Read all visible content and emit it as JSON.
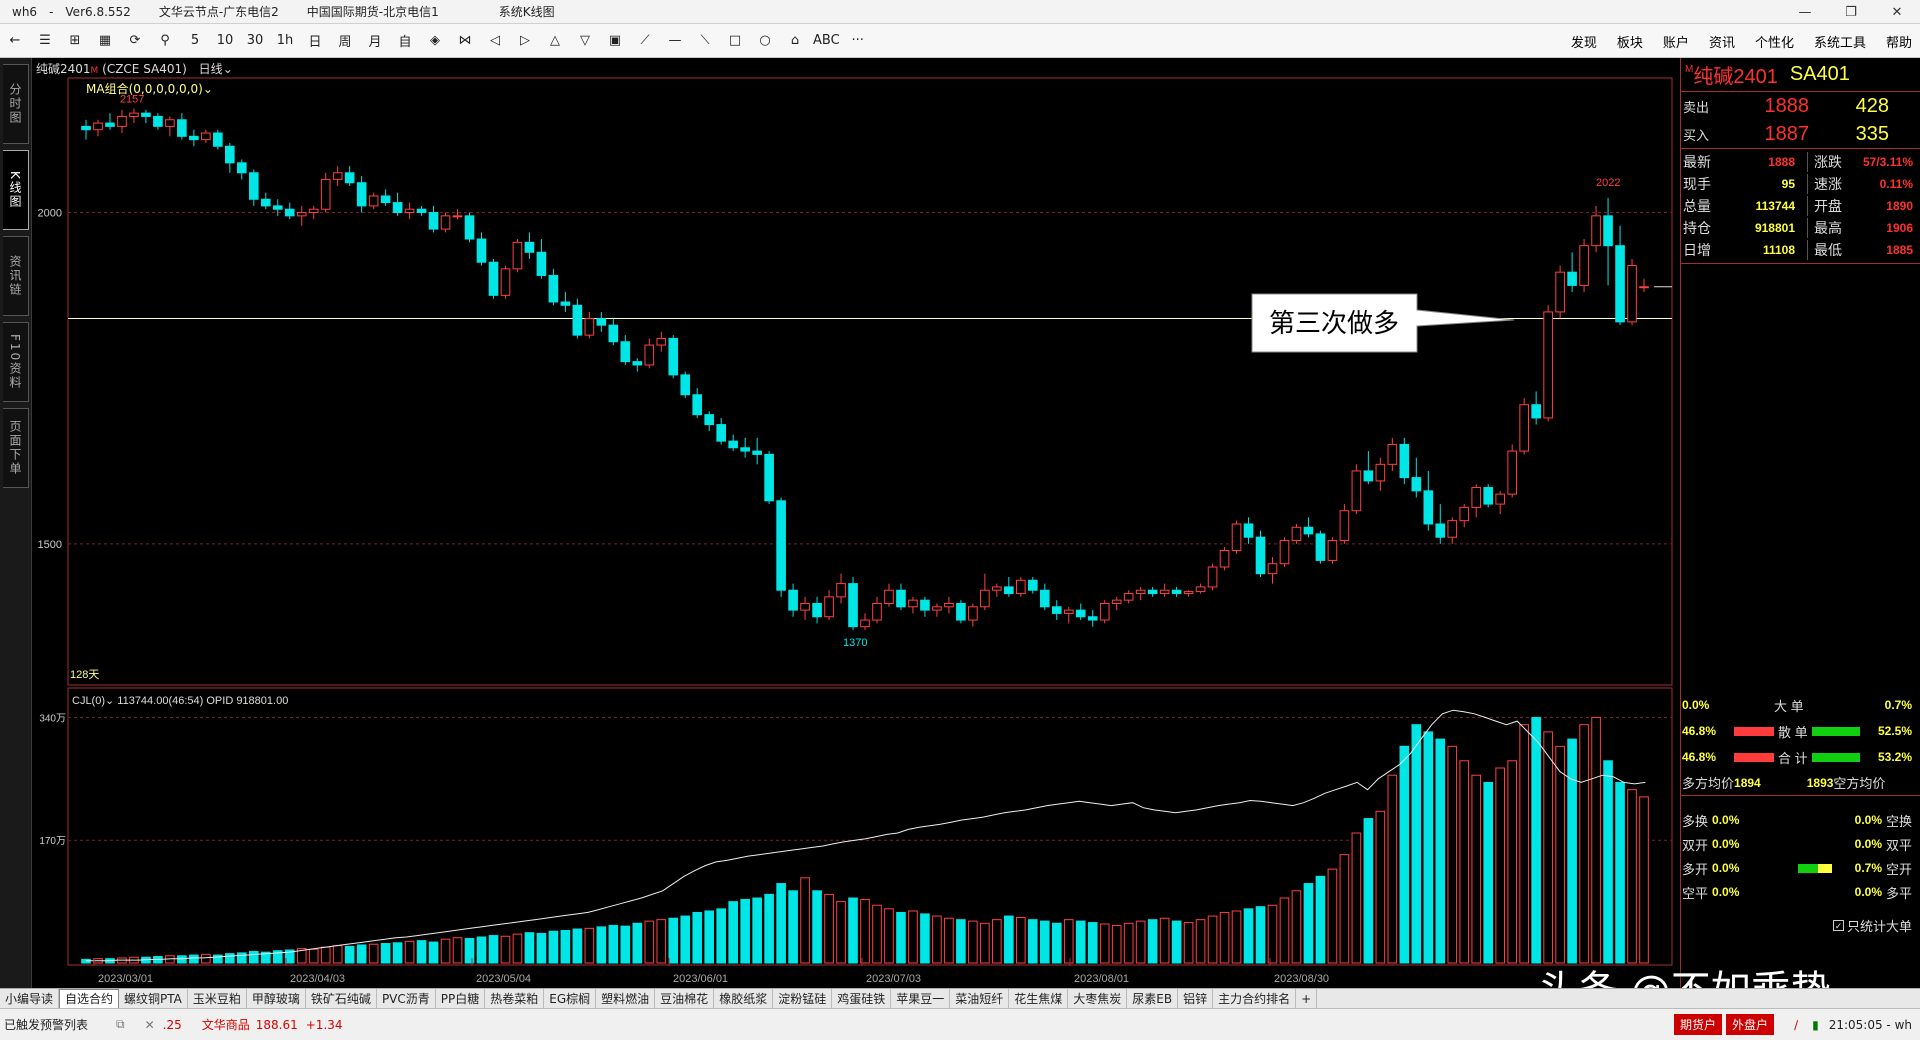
{
  "window": {
    "app": "wh6",
    "dash": "-",
    "version": "Ver6.8.552",
    "server1": "文华云节点-广东电信2",
    "server2": "中国国际期货-北京电信1",
    "title": "系统K线图",
    "minimize": "—",
    "restore": "❐",
    "close": "✕"
  },
  "toolbar": {
    "items": [
      "←",
      "☰",
      "⊞",
      "▦",
      "⟳",
      "⚲",
      "5",
      "10",
      "30",
      "1h",
      "日",
      "周",
      "月",
      "自",
      "◈",
      "⋈",
      "◁",
      "▷",
      "△",
      "▽",
      "▣",
      "⟋",
      "—",
      "⟍",
      "□",
      "○",
      "⌂",
      "ABC",
      "···"
    ],
    "right_menu": [
      "发现",
      "板块",
      "账户",
      "资讯",
      "个性化",
      "系统工具",
      "帮助"
    ]
  },
  "left_tabs": [
    "分时图",
    "K线图",
    "资讯链",
    "F10资料",
    "页面下单"
  ],
  "chart_header": {
    "symbol": "纯碱2401",
    "mark": "M",
    "code": "(CZCE SA401)",
    "period": "日线",
    "ma_label": "MA组合(0,0,0,0,0,0)",
    "days_label": "128天",
    "annotation": "第三次做多",
    "high_label": "2157",
    "low_label": "1370",
    "recent_high_label": "2022",
    "y_tick_2000": "2000",
    "y_tick_1500": "1500",
    "vol_header": "CJL(0)",
    "vol_value": "113744.00(46:54)",
    "opid": "OPID 918801.00",
    "vol_tick_340": "340万",
    "vol_tick_170": "170万"
  },
  "chart_data": {
    "type": "candlestick",
    "title": "纯碱2401 (CZCE SA401) 日线",
    "x_ticks": [
      "2023/03/01",
      "2023/04/03",
      "2023/05/04",
      "2023/06/01",
      "2023/07/03",
      "2023/08/01",
      "2023/08/30"
    ],
    "y_ticks": [
      2000,
      1500
    ],
    "ylim": [
      1290,
      2200
    ],
    "annotations": [
      {
        "text": "2157",
        "value": 2157
      },
      {
        "text": "1370",
        "value": 1370
      },
      {
        "text": "2022",
        "value": 2022
      },
      {
        "text": "第三次做多",
        "value": 1830
      }
    ],
    "horizontal_line": 1840,
    "ohlc": [
      [
        2130,
        2140,
        2110,
        2125
      ],
      [
        2125,
        2140,
        2115,
        2135
      ],
      [
        2135,
        2150,
        2125,
        2130
      ],
      [
        2130,
        2155,
        2120,
        2145
      ],
      [
        2145,
        2157,
        2135,
        2150
      ],
      [
        2150,
        2155,
        2135,
        2145
      ],
      [
        2145,
        2150,
        2125,
        2130
      ],
      [
        2130,
        2145,
        2115,
        2140
      ],
      [
        2140,
        2150,
        2110,
        2115
      ],
      [
        2115,
        2125,
        2100,
        2110
      ],
      [
        2110,
        2125,
        2105,
        2120
      ],
      [
        2120,
        2125,
        2095,
        2100
      ],
      [
        2100,
        2105,
        2060,
        2075
      ],
      [
        2075,
        2080,
        2050,
        2060
      ],
      [
        2060,
        2065,
        2010,
        2020
      ],
      [
        2020,
        2030,
        2005,
        2010
      ],
      [
        2010,
        2020,
        1995,
        2005
      ],
      [
        2005,
        2015,
        1990,
        1995
      ],
      [
        1995,
        2010,
        1980,
        2000
      ],
      [
        2000,
        2010,
        1990,
        2005
      ],
      [
        2005,
        2060,
        2000,
        2050
      ],
      [
        2050,
        2070,
        2040,
        2060
      ],
      [
        2060,
        2070,
        2040,
        2045
      ],
      [
        2045,
        2055,
        2000,
        2010
      ],
      [
        2010,
        2030,
        2005,
        2025
      ],
      [
        2025,
        2035,
        2010,
        2015
      ],
      [
        2015,
        2030,
        1995,
        2000
      ],
      [
        2000,
        2015,
        1990,
        2005
      ],
      [
        2005,
        2010,
        1995,
        2000
      ],
      [
        2000,
        2010,
        1970,
        1975
      ],
      [
        1975,
        2000,
        1970,
        1995
      ],
      [
        1995,
        2005,
        1990,
        1995
      ],
      [
        1995,
        2000,
        1955,
        1960
      ],
      [
        1960,
        1970,
        1920,
        1925
      ],
      [
        1925,
        1930,
        1870,
        1875
      ],
      [
        1875,
        1920,
        1870,
        1915
      ],
      [
        1915,
        1960,
        1910,
        1955
      ],
      [
        1955,
        1970,
        1930,
        1940
      ],
      [
        1940,
        1960,
        1900,
        1905
      ],
      [
        1905,
        1915,
        1860,
        1865
      ],
      [
        1865,
        1880,
        1850,
        1860
      ],
      [
        1860,
        1870,
        1810,
        1815
      ],
      [
        1815,
        1850,
        1810,
        1840
      ],
      [
        1840,
        1850,
        1820,
        1830
      ],
      [
        1830,
        1840,
        1800,
        1805
      ],
      [
        1805,
        1815,
        1770,
        1775
      ],
      [
        1775,
        1780,
        1760,
        1770
      ],
      [
        1770,
        1810,
        1765,
        1800
      ],
      [
        1800,
        1820,
        1790,
        1810
      ],
      [
        1810,
        1815,
        1750,
        1755
      ],
      [
        1755,
        1760,
        1720,
        1725
      ],
      [
        1725,
        1735,
        1690,
        1695
      ],
      [
        1695,
        1700,
        1670,
        1680
      ],
      [
        1680,
        1690,
        1650,
        1655
      ],
      [
        1655,
        1665,
        1640,
        1645
      ],
      [
        1645,
        1660,
        1630,
        1640
      ],
      [
        1640,
        1660,
        1620,
        1635
      ],
      [
        1635,
        1640,
        1560,
        1565
      ],
      [
        1565,
        1570,
        1420,
        1430
      ],
      [
        1430,
        1440,
        1390,
        1400
      ],
      [
        1400,
        1420,
        1385,
        1410
      ],
      [
        1410,
        1420,
        1380,
        1390
      ],
      [
        1390,
        1430,
        1385,
        1420
      ],
      [
        1420,
        1455,
        1410,
        1440
      ],
      [
        1440,
        1450,
        1370,
        1375
      ],
      [
        1375,
        1395,
        1370,
        1385
      ],
      [
        1385,
        1420,
        1380,
        1410
      ],
      [
        1410,
        1440,
        1405,
        1430
      ],
      [
        1430,
        1440,
        1400,
        1405
      ],
      [
        1405,
        1420,
        1395,
        1415
      ],
      [
        1415,
        1420,
        1390,
        1400
      ],
      [
        1400,
        1410,
        1390,
        1405
      ],
      [
        1405,
        1420,
        1395,
        1410
      ],
      [
        1410,
        1415,
        1380,
        1385
      ],
      [
        1385,
        1410,
        1375,
        1405
      ],
      [
        1405,
        1455,
        1400,
        1430
      ],
      [
        1430,
        1440,
        1420,
        1435
      ],
      [
        1435,
        1450,
        1420,
        1425
      ],
      [
        1425,
        1450,
        1420,
        1445
      ],
      [
        1445,
        1450,
        1425,
        1430
      ],
      [
        1430,
        1440,
        1400,
        1405
      ],
      [
        1405,
        1415,
        1385,
        1395
      ],
      [
        1395,
        1405,
        1380,
        1400
      ],
      [
        1400,
        1410,
        1385,
        1390
      ],
      [
        1390,
        1400,
        1375,
        1385
      ],
      [
        1385,
        1415,
        1380,
        1410
      ],
      [
        1410,
        1420,
        1400,
        1415
      ],
      [
        1415,
        1430,
        1410,
        1425
      ],
      [
        1425,
        1435,
        1415,
        1430
      ],
      [
        1430,
        1435,
        1420,
        1425
      ],
      [
        1425,
        1440,
        1420,
        1430
      ],
      [
        1430,
        1435,
        1420,
        1425
      ],
      [
        1425,
        1430,
        1420,
        1428
      ],
      [
        1428,
        1440,
        1425,
        1435
      ],
      [
        1435,
        1470,
        1430,
        1465
      ],
      [
        1465,
        1495,
        1460,
        1490
      ],
      [
        1490,
        1535,
        1485,
        1530
      ],
      [
        1530,
        1540,
        1500,
        1510
      ],
      [
        1510,
        1520,
        1450,
        1455
      ],
      [
        1455,
        1480,
        1440,
        1470
      ],
      [
        1470,
        1510,
        1465,
        1505
      ],
      [
        1505,
        1530,
        1500,
        1525
      ],
      [
        1525,
        1540,
        1510,
        1515
      ],
      [
        1515,
        1520,
        1470,
        1475
      ],
      [
        1475,
        1510,
        1470,
        1505
      ],
      [
        1505,
        1560,
        1500,
        1550
      ],
      [
        1550,
        1620,
        1545,
        1610
      ],
      [
        1610,
        1640,
        1590,
        1595
      ],
      [
        1595,
        1630,
        1580,
        1620
      ],
      [
        1620,
        1660,
        1610,
        1650
      ],
      [
        1650,
        1660,
        1590,
        1600
      ],
      [
        1600,
        1630,
        1570,
        1580
      ],
      [
        1580,
        1610,
        1520,
        1530
      ],
      [
        1530,
        1560,
        1500,
        1510
      ],
      [
        1510,
        1540,
        1500,
        1535
      ],
      [
        1535,
        1560,
        1525,
        1555
      ],
      [
        1555,
        1590,
        1540,
        1585
      ],
      [
        1585,
        1590,
        1555,
        1560
      ],
      [
        1560,
        1580,
        1545,
        1575
      ],
      [
        1575,
        1650,
        1570,
        1640
      ],
      [
        1640,
        1720,
        1635,
        1710
      ],
      [
        1710,
        1730,
        1680,
        1690
      ],
      [
        1690,
        1860,
        1685,
        1850
      ],
      [
        1850,
        1920,
        1840,
        1910
      ],
      [
        1910,
        1940,
        1880,
        1890
      ],
      [
        1890,
        1960,
        1880,
        1950
      ],
      [
        1950,
        2010,
        1940,
        1995
      ],
      [
        1995,
        2022,
        1890,
        1950
      ],
      [
        1950,
        1980,
        1830,
        1835
      ],
      [
        1835,
        1930,
        1830,
        1920
      ],
      [
        1887,
        1900,
        1880,
        1888
      ]
    ],
    "volume_wan": [
      5,
      6,
      6,
      7,
      8,
      8,
      9,
      10,
      10,
      11,
      12,
      11,
      13,
      14,
      16,
      15,
      17,
      18,
      20,
      19,
      22,
      24,
      23,
      25,
      26,
      27,
      28,
      30,
      31,
      29,
      33,
      35,
      34,
      36,
      38,
      37,
      40,
      42,
      41,
      44,
      45,
      47,
      48,
      50,
      52,
      51,
      55,
      58,
      60,
      62,
      65,
      70,
      72,
      75,
      85,
      88,
      90,
      95,
      110,
      100,
      118,
      100,
      95,
      85,
      90,
      88,
      80,
      75,
      70,
      72,
      68,
      65,
      62,
      60,
      58,
      55,
      60,
      65,
      63,
      60,
      58,
      55,
      60,
      58,
      56,
      54,
      52,
      55,
      58,
      60,
      62,
      58,
      56,
      60,
      65,
      70,
      72,
      75,
      78,
      80,
      90,
      100,
      110,
      120,
      130,
      150,
      180,
      200,
      210,
      260,
      300,
      330,
      320,
      310,
      300,
      280,
      260,
      250,
      270,
      280,
      330,
      340,
      320,
      300,
      310,
      330,
      340,
      280,
      250,
      240,
      230,
      6
    ],
    "open_interest_wan": [
      3,
      3,
      3,
      4,
      4,
      4,
      5,
      5,
      6,
      6,
      7,
      7,
      8,
      9,
      10,
      11,
      12,
      13,
      14,
      15,
      17,
      19,
      21,
      23,
      25,
      27,
      29,
      31,
      33,
      35,
      36,
      38,
      40,
      42,
      44,
      46,
      48,
      50,
      52,
      54,
      56,
      58,
      60,
      62,
      64,
      66,
      68,
      70,
      74,
      78,
      82,
      86,
      90,
      95,
      100,
      110,
      120,
      128,
      135,
      140,
      142,
      145,
      148,
      150,
      152,
      154,
      156,
      158,
      160,
      162,
      165,
      168,
      170,
      172,
      175,
      178,
      180,
      185,
      188,
      190,
      192,
      195,
      198,
      200,
      202,
      205,
      208,
      210,
      212,
      215,
      218,
      220,
      222,
      224,
      222,
      220,
      218,
      220,
      222,
      215,
      212,
      210,
      208,
      210,
      212,
      215,
      218,
      220,
      222,
      225,
      224,
      222,
      220,
      218,
      222,
      228,
      235,
      240,
      245,
      250,
      240,
      255,
      265,
      275,
      290,
      310,
      330,
      345,
      350,
      348,
      345,
      340,
      335,
      330,
      335,
      320,
      305,
      285,
      265,
      255,
      250,
      255,
      260,
      258,
      250,
      248,
      250
    ]
  },
  "quote": {
    "mark": "M",
    "name": "纯碱2401",
    "code": "SA401",
    "ask_label": "卖出",
    "ask_price": "1888",
    "ask_vol": "428",
    "bid_label": "买入",
    "bid_price": "1887",
    "bid_vol": "335",
    "rows": [
      {
        "l1": "最新",
        "v1": "1888",
        "l2": "涨跌",
        "v2": "57/3.11%"
      },
      {
        "l1": "现手",
        "v1": "95",
        "l2": "速涨",
        "v2": "0.11%"
      },
      {
        "l1": "总量",
        "v1": "113744",
        "l2": "开盘",
        "v2": "1890"
      },
      {
        "l1": "持仓",
        "v1": "918801",
        "l2": "最高",
        "v2": "1906"
      },
      {
        "l1": "日增",
        "v1": "11108",
        "l2": "最低",
        "v2": "1885"
      }
    ]
  },
  "flow": {
    "big_left": "0.0%",
    "big_label": "大 单",
    "big_right": "0.7%",
    "retail_left": "46.8%",
    "retail_label": "散 单",
    "retail_right": "52.5%",
    "total_left": "46.8%",
    "total_label": "合 计",
    "total_right": "53.2%",
    "long_avg_label": "多方均价",
    "long_avg": "1894",
    "short_avg": "1893",
    "short_avg_label": "空方均价",
    "rows": [
      {
        "l": "多换",
        "lv": "0.0%",
        "rv": "0.0%",
        "r": "空换"
      },
      {
        "l": "双开",
        "lv": "0.0%",
        "rv": "0.0%",
        "r": "双平"
      },
      {
        "l": "多开",
        "lv": "0.0%",
        "rv": "0.7%",
        "r": "空开"
      },
      {
        "l": "空平",
        "lv": "0.0%",
        "rv": "0.0%",
        "r": "多平"
      }
    ],
    "checkbox_label": "只统计大单"
  },
  "bottom_tabs": [
    "小编导读",
    "自选合约",
    "螺纹铜PTA",
    "玉米豆粕",
    "甲醇玻璃",
    "铁矿石纯碱",
    "PVC沥青",
    "PP白糖",
    "热卷菜粕",
    "EG棕榈",
    "塑料燃油",
    "豆油棉花",
    "橡胶纸浆",
    "淀粉锰硅",
    "鸡蛋硅铁",
    "苹果豆一",
    "菜油短纤",
    "花生焦煤",
    "大枣焦炭",
    "尿素EB",
    "铝锌",
    "主力合约排名",
    "+"
  ],
  "status": {
    "left": "已触发预警列表",
    "ticker_tail": ".25",
    "ticker_name": "文华商品",
    "ticker_value": "188.61",
    "ticker_change": "+1.34",
    "btn1": "期货户",
    "btn2": "外盘户",
    "time": "21:05:05 - wh"
  },
  "watermark": "头条 @不如乘势"
}
